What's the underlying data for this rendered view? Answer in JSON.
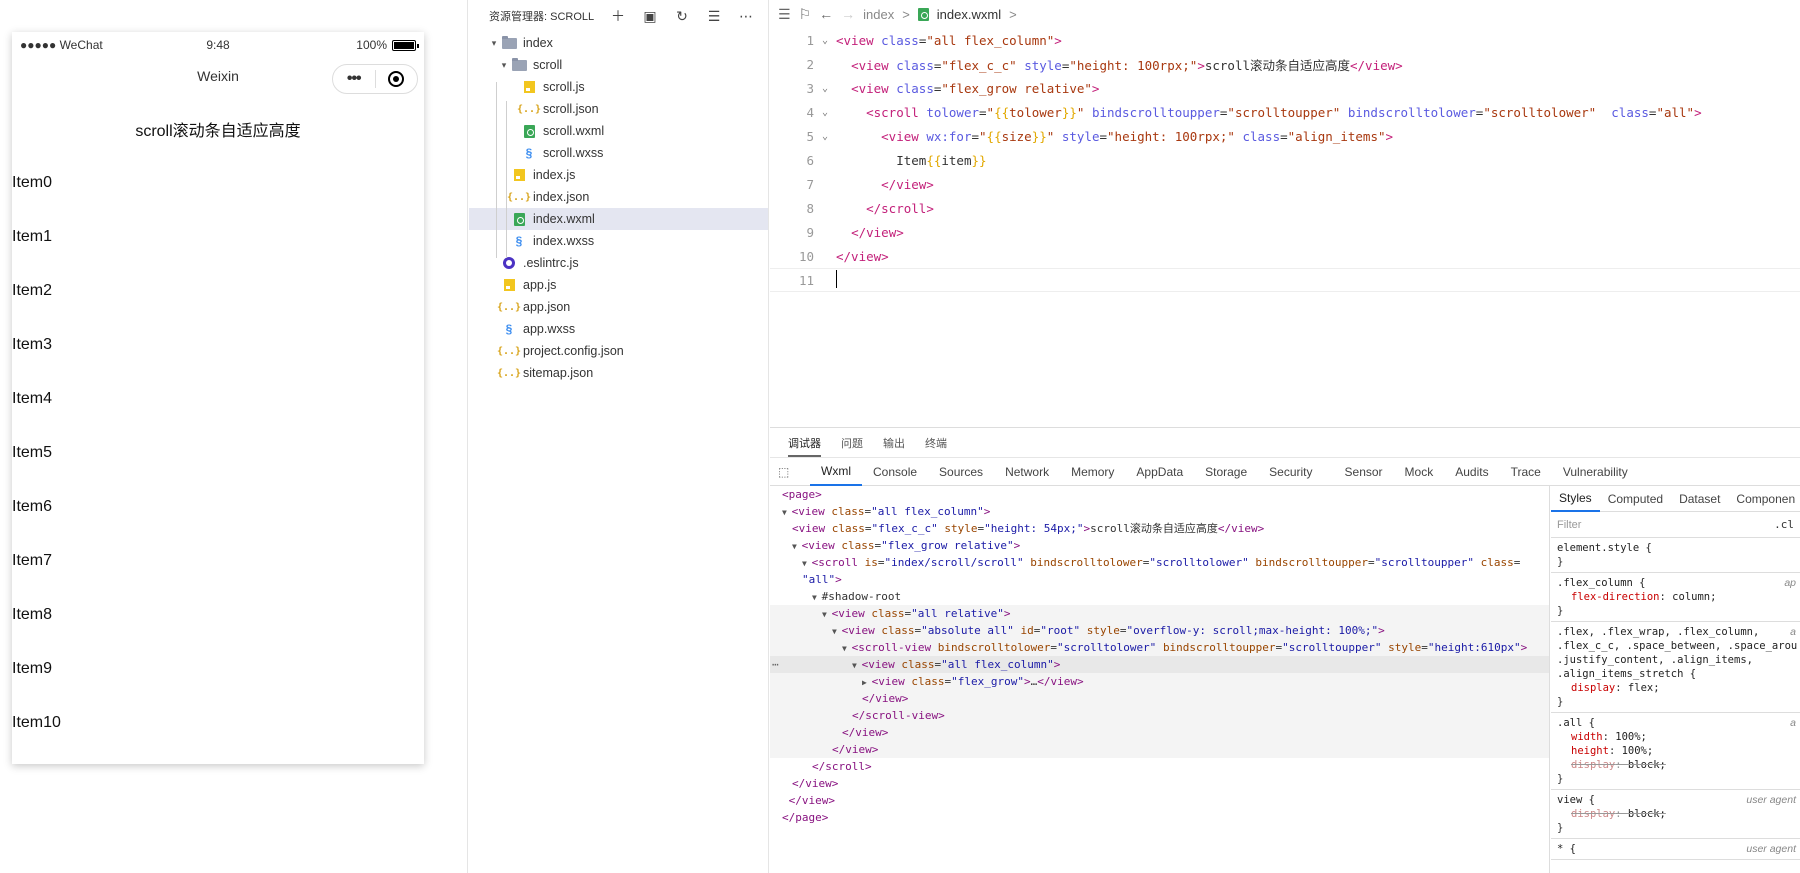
{
  "simulator": {
    "status": {
      "carrier": "●●●●● WeChat",
      "time": "9:48",
      "battery": "100%"
    },
    "nav_title": "Weixin",
    "capsule_menu": "•••",
    "page_title": "scroll滚动条自适应高度",
    "items": [
      "Item0",
      "Item1",
      "Item2",
      "Item3",
      "Item4",
      "Item5",
      "Item6",
      "Item7",
      "Item8",
      "Item9",
      "Item10"
    ]
  },
  "explorer": {
    "title": "资源管理器: SCROLL",
    "tree": [
      {
        "label": "index",
        "icon": "folder-open-icon",
        "depth": 0,
        "twisty": "▾"
      },
      {
        "label": "scroll",
        "icon": "folder-open-icon",
        "depth": 1,
        "twisty": "▾"
      },
      {
        "label": "scroll.js",
        "icon": "js-file-icon",
        "depth": 2
      },
      {
        "label": "scroll.json",
        "icon": "json-file-icon",
        "depth": 2
      },
      {
        "label": "scroll.wxml",
        "icon": "wxml-file-icon",
        "depth": 2
      },
      {
        "label": "scroll.wxss",
        "icon": "wxss-file-icon",
        "depth": 2
      },
      {
        "label": "index.js",
        "icon": "js-file-icon",
        "depth": 1
      },
      {
        "label": "index.json",
        "icon": "json-file-icon",
        "depth": 1
      },
      {
        "label": "index.wxml",
        "icon": "wxml-file-icon",
        "depth": 1,
        "selected": true
      },
      {
        "label": "index.wxss",
        "icon": "wxss-file-icon",
        "depth": 1
      },
      {
        "label": ".eslintrc.js",
        "icon": "eslint-file-icon",
        "depth": 0
      },
      {
        "label": "app.js",
        "icon": "js-file-icon",
        "depth": 0
      },
      {
        "label": "app.json",
        "icon": "json-file-icon",
        "depth": 0
      },
      {
        "label": "app.wxss",
        "icon": "wxss-file-icon",
        "depth": 0
      },
      {
        "label": "project.config.json",
        "icon": "json-file-icon",
        "depth": 0
      },
      {
        "label": "sitemap.json",
        "icon": "json-file-icon",
        "depth": 0
      }
    ]
  },
  "editor": {
    "breadcrumb": {
      "folder": "index",
      "file": "index.wxml",
      "sep": ">"
    },
    "lines": [
      {
        "n": "1",
        "fold": "⌄",
        "html": "<span class=\"tag\">&lt;view</span> <span class=\"attr\">class</span>=<span class=\"val\">\"all flex_column\"</span><span class=\"tag\">&gt;</span>"
      },
      {
        "n": "2",
        "fold": "",
        "html": "  <span class=\"tag\">&lt;view</span> <span class=\"attr\">class</span>=<span class=\"val\">\"flex_c_c\"</span> <span class=\"attr\">style</span>=<span class=\"val\">\"height: 100rpx;\"</span><span class=\"tag\">&gt;</span>scroll滚动条自适应高度<span class=\"tag\">&lt;/view&gt;</span>"
      },
      {
        "n": "3",
        "fold": "⌄",
        "html": "  <span class=\"tag\">&lt;view</span> <span class=\"attr\">class</span>=<span class=\"val\">\"flex_grow relative\"</span><span class=\"tag\">&gt;</span>"
      },
      {
        "n": "4",
        "fold": "⌄",
        "html": "    <span class=\"tag\">&lt;scroll</span> <span class=\"attr\">tolower</span>=<span class=\"val\">\"<span class=\"br\">{{</span>tolower<span class=\"br\">}}</span>\"</span> <span class=\"attr\">bindscrolltoupper</span>=<span class=\"val\">\"scrolltoupper\"</span> <span class=\"attr\">bindscrolltolower</span>=<span class=\"val\">\"scrolltolower\"</span>  <span class=\"attr\">class</span>=<span class=\"val\">\"all\"</span><span class=\"tag\">&gt;</span>"
      },
      {
        "n": "5",
        "fold": "⌄",
        "html": "      <span class=\"tag\">&lt;view</span> <span class=\"attr\">wx:for</span>=<span class=\"val\">\"<span class=\"br\">{{</span>size<span class=\"br\">}}</span>\"</span> <span class=\"attr\">style</span>=<span class=\"val\">\"height: 100rpx;\"</span> <span class=\"attr\">class</span>=<span class=\"val\">\"align_items\"</span><span class=\"tag\">&gt;</span>"
      },
      {
        "n": "6",
        "fold": "",
        "html": "        Item<span class=\"br\">{{</span>item<span class=\"br\">}}</span>"
      },
      {
        "n": "7",
        "fold": "",
        "html": "      <span class=\"tag\">&lt;/view&gt;</span>"
      },
      {
        "n": "8",
        "fold": "",
        "html": "    <span class=\"tag\">&lt;/scroll&gt;</span>"
      },
      {
        "n": "9",
        "fold": "",
        "html": "  <span class=\"tag\">&lt;/view&gt;</span>"
      },
      {
        "n": "10",
        "fold": "",
        "html": "<span class=\"tag\">&lt;/view&gt;</span>"
      },
      {
        "n": "11",
        "fold": "",
        "html": "",
        "current": true
      }
    ]
  },
  "devtools": {
    "top_tabs": [
      "调试器",
      "问题",
      "输出",
      "终端"
    ],
    "tabs": [
      "Wxml",
      "Console",
      "Sources",
      "Network",
      "Memory",
      "AppData",
      "Storage",
      "Security",
      "Sensor",
      "Mock",
      "Audits",
      "Trace",
      "Vulnerability"
    ],
    "dom_lines": [
      {
        "indent": 0,
        "arrow": "",
        "html": "<span class=\"tg\">&lt;page&gt;</span>"
      },
      {
        "indent": 0,
        "arrow": "▼",
        "html": "<span class=\"tg\">&lt;view</span> <span class=\"an\">class</span>=<span class=\"av\">\"all flex_column\"</span><span class=\"tg\">&gt;</span>"
      },
      {
        "indent": 1,
        "arrow": "",
        "html": "<span class=\"tg\">&lt;view</span> <span class=\"an\">class</span>=<span class=\"av\">\"flex_c_c\"</span> <span class=\"an\">style</span>=<span class=\"av\">\"height: 54px;\"</span><span class=\"tg\">&gt;</span>scroll滚动条自适应高度<span class=\"tg\">&lt;/view&gt;</span>"
      },
      {
        "indent": 1,
        "arrow": "▼",
        "html": "<span class=\"tg\">&lt;view</span> <span class=\"an\">class</span>=<span class=\"av\">\"flex_grow relative\"</span><span class=\"tg\">&gt;</span>"
      },
      {
        "indent": 2,
        "arrow": "▼",
        "html": "<span class=\"tg\">&lt;scroll</span> <span class=\"an\">is</span>=<span class=\"av\">\"index/scroll/scroll\"</span> <span class=\"an\">bindscrolltolower</span>=<span class=\"av\">\"scrolltolower\"</span> <span class=\"an\">bindscrolltoupper</span>=<span class=\"av\">\"scrolltoupper\"</span> <span class=\"an\">class</span>="
      },
      {
        "indent": 2,
        "arrow": "",
        "html": "<span class=\"av\">\"all\"</span><span class=\"tg\">&gt;</span>"
      },
      {
        "indent": 3,
        "arrow": "▼",
        "html": "#shadow-root"
      },
      {
        "indent": 4,
        "arrow": "▼",
        "html": "<span class=\"tg\">&lt;view</span> <span class=\"an\">class</span>=<span class=\"av\">\"all relative\"</span><span class=\"tg\">&gt;</span>",
        "shade": true
      },
      {
        "indent": 5,
        "arrow": "▼",
        "html": "<span class=\"tg\">&lt;view</span> <span class=\"an\">class</span>=<span class=\"av\">\"absolute all\"</span> <span class=\"an\">id</span>=<span class=\"av\">\"root\"</span> <span class=\"an\">style</span>=<span class=\"av\">\"overflow-y: scroll;max-height: 100%;\"</span><span class=\"tg\">&gt;</span>",
        "shade": true
      },
      {
        "indent": 6,
        "arrow": "▼",
        "html": "<span class=\"tg\">&lt;scroll-view</span> <span class=\"an\">bindscrolltolower</span>=<span class=\"av\">\"scrolltolower\"</span> <span class=\"an\">bindscrolltoupper</span>=<span class=\"av\">\"scrolltoupper\"</span> <span class=\"an\">style</span>=<span class=\"av\">\"height:610px\"</span><span class=\"tg\">&gt;</span>",
        "shade": true
      },
      {
        "indent": 7,
        "arrow": "▼",
        "html": "<span class=\"tg\">&lt;view</span> <span class=\"an\">class</span>=<span class=\"av\">\"all flex_column\"</span><span class=\"tg\">&gt;</span>",
        "selected": true
      },
      {
        "indent": 8,
        "arrow": "▶",
        "html": "<span class=\"tg\">&lt;view</span> <span class=\"an\">class</span>=<span class=\"av\">\"flex_grow\"</span><span class=\"tg\">&gt;</span>…<span class=\"tg\">&lt;/view&gt;</span>",
        "shade": true
      },
      {
        "indent": 8,
        "arrow": "",
        "html": "<span class=\"tg\">&lt;/view&gt;</span>",
        "shade": true
      },
      {
        "indent": 7,
        "arrow": "",
        "html": "<span class=\"tg\">&lt;/scroll-view&gt;</span>",
        "shade": true
      },
      {
        "indent": 6,
        "arrow": "",
        "html": "<span class=\"tg\">&lt;/view&gt;</span>",
        "shade": true
      },
      {
        "indent": 5,
        "arrow": "",
        "html": "<span class=\"tg\">&lt;/view&gt;</span>",
        "shade": true
      },
      {
        "indent": 3,
        "arrow": "",
        "html": "<span class=\"tg\">&lt;/scroll&gt;</span>"
      },
      {
        "indent": 1,
        "arrow": "",
        "html": "<span class=\"tg\">&lt;/view&gt;</span>"
      },
      {
        "indent": 0,
        "arrow": "",
        "html": " <span class=\"tg\">&lt;/view&gt;</span>"
      },
      {
        "indent": 0,
        "arrow": "",
        "html": "<span class=\"tg\">&lt;/page&gt;</span>"
      }
    ],
    "styles_tabs": [
      "Styles",
      "Computed",
      "Dataset",
      "Componen"
    ],
    "filter_placeholder": "Filter",
    "filter_cls": ".cl",
    "rules": [
      {
        "selector": "element.style {",
        "src": "",
        "decls": [],
        "close": "}"
      },
      {
        "selector": ".flex_column {",
        "src": "ap",
        "decls": [
          {
            "p": "flex-direction",
            "v": "column;"
          }
        ],
        "close": "}"
      },
      {
        "selector": ".flex, .flex_wrap, .flex_column,\n.flex_c_c, .space_between, .space_arou\n.justify_content, .align_items,\n.align_items_stretch {",
        "src": "a",
        "decls": [
          {
            "p": "display",
            "v": "flex;"
          }
        ],
        "close": "}"
      },
      {
        "selector": ".all {",
        "src": "a",
        "decls": [
          {
            "p": "width",
            "v": "100%;"
          },
          {
            "p": "height",
            "v": "100%;"
          },
          {
            "p": "display",
            "v": "block;",
            "strike": true
          }
        ],
        "close": "}"
      },
      {
        "selector": "view {",
        "src": "user agent",
        "decls": [
          {
            "p": "display",
            "v": "block;",
            "strike": true
          }
        ],
        "close": "}"
      },
      {
        "selector": "* {",
        "src": "user agent",
        "decls": [],
        "close": ""
      }
    ]
  }
}
